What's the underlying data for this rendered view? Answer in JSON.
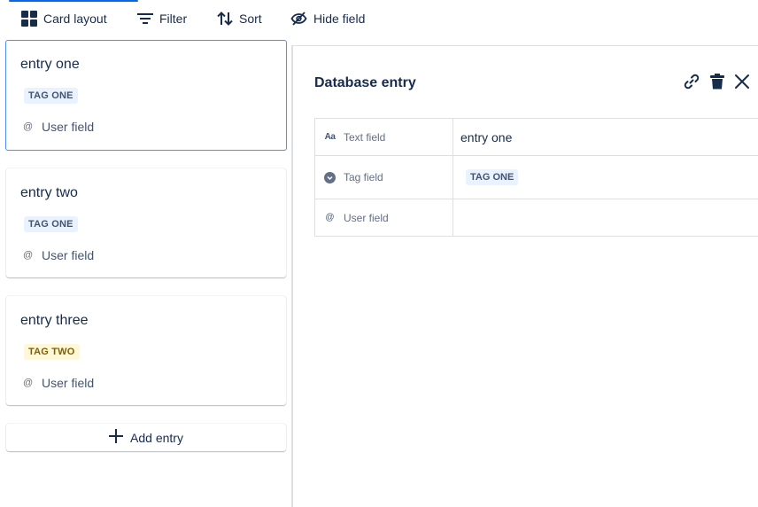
{
  "toolbar": {
    "card_layout_label": "Card layout",
    "filter_label": "Filter",
    "sort_label": "Sort",
    "hide_field_label": "Hide field"
  },
  "cards": [
    {
      "title": "entry one",
      "tag": "TAG ONE",
      "tag_color": "#e9f2ff",
      "user_label": "User field",
      "selected": true
    },
    {
      "title": "entry two",
      "tag": "TAG ONE",
      "tag_color": "#e9f2ff",
      "user_label": "User field",
      "selected": false
    },
    {
      "title": "entry three",
      "tag": "TAG TWO",
      "tag_color": "#fff7d6",
      "user_label": "User field",
      "selected": false
    }
  ],
  "add_entry_label": "Add entry",
  "panel": {
    "title": "Database entry",
    "actions": [
      "link-icon",
      "trash-icon",
      "close-icon"
    ],
    "fields": [
      {
        "icon": "Aa",
        "name": "Text field",
        "value": "entry one"
      },
      {
        "icon": "chevron-circle-icon",
        "name": "Tag field",
        "value": "TAG ONE"
      },
      {
        "icon": "@",
        "name": "User field",
        "value": ""
      }
    ]
  },
  "colors": {
    "accent": "#0c66e4",
    "selected_border": "#4f8ef7",
    "text": "#172b4d",
    "subtle_text": "#44546f",
    "divider": "#dcdfe4"
  }
}
